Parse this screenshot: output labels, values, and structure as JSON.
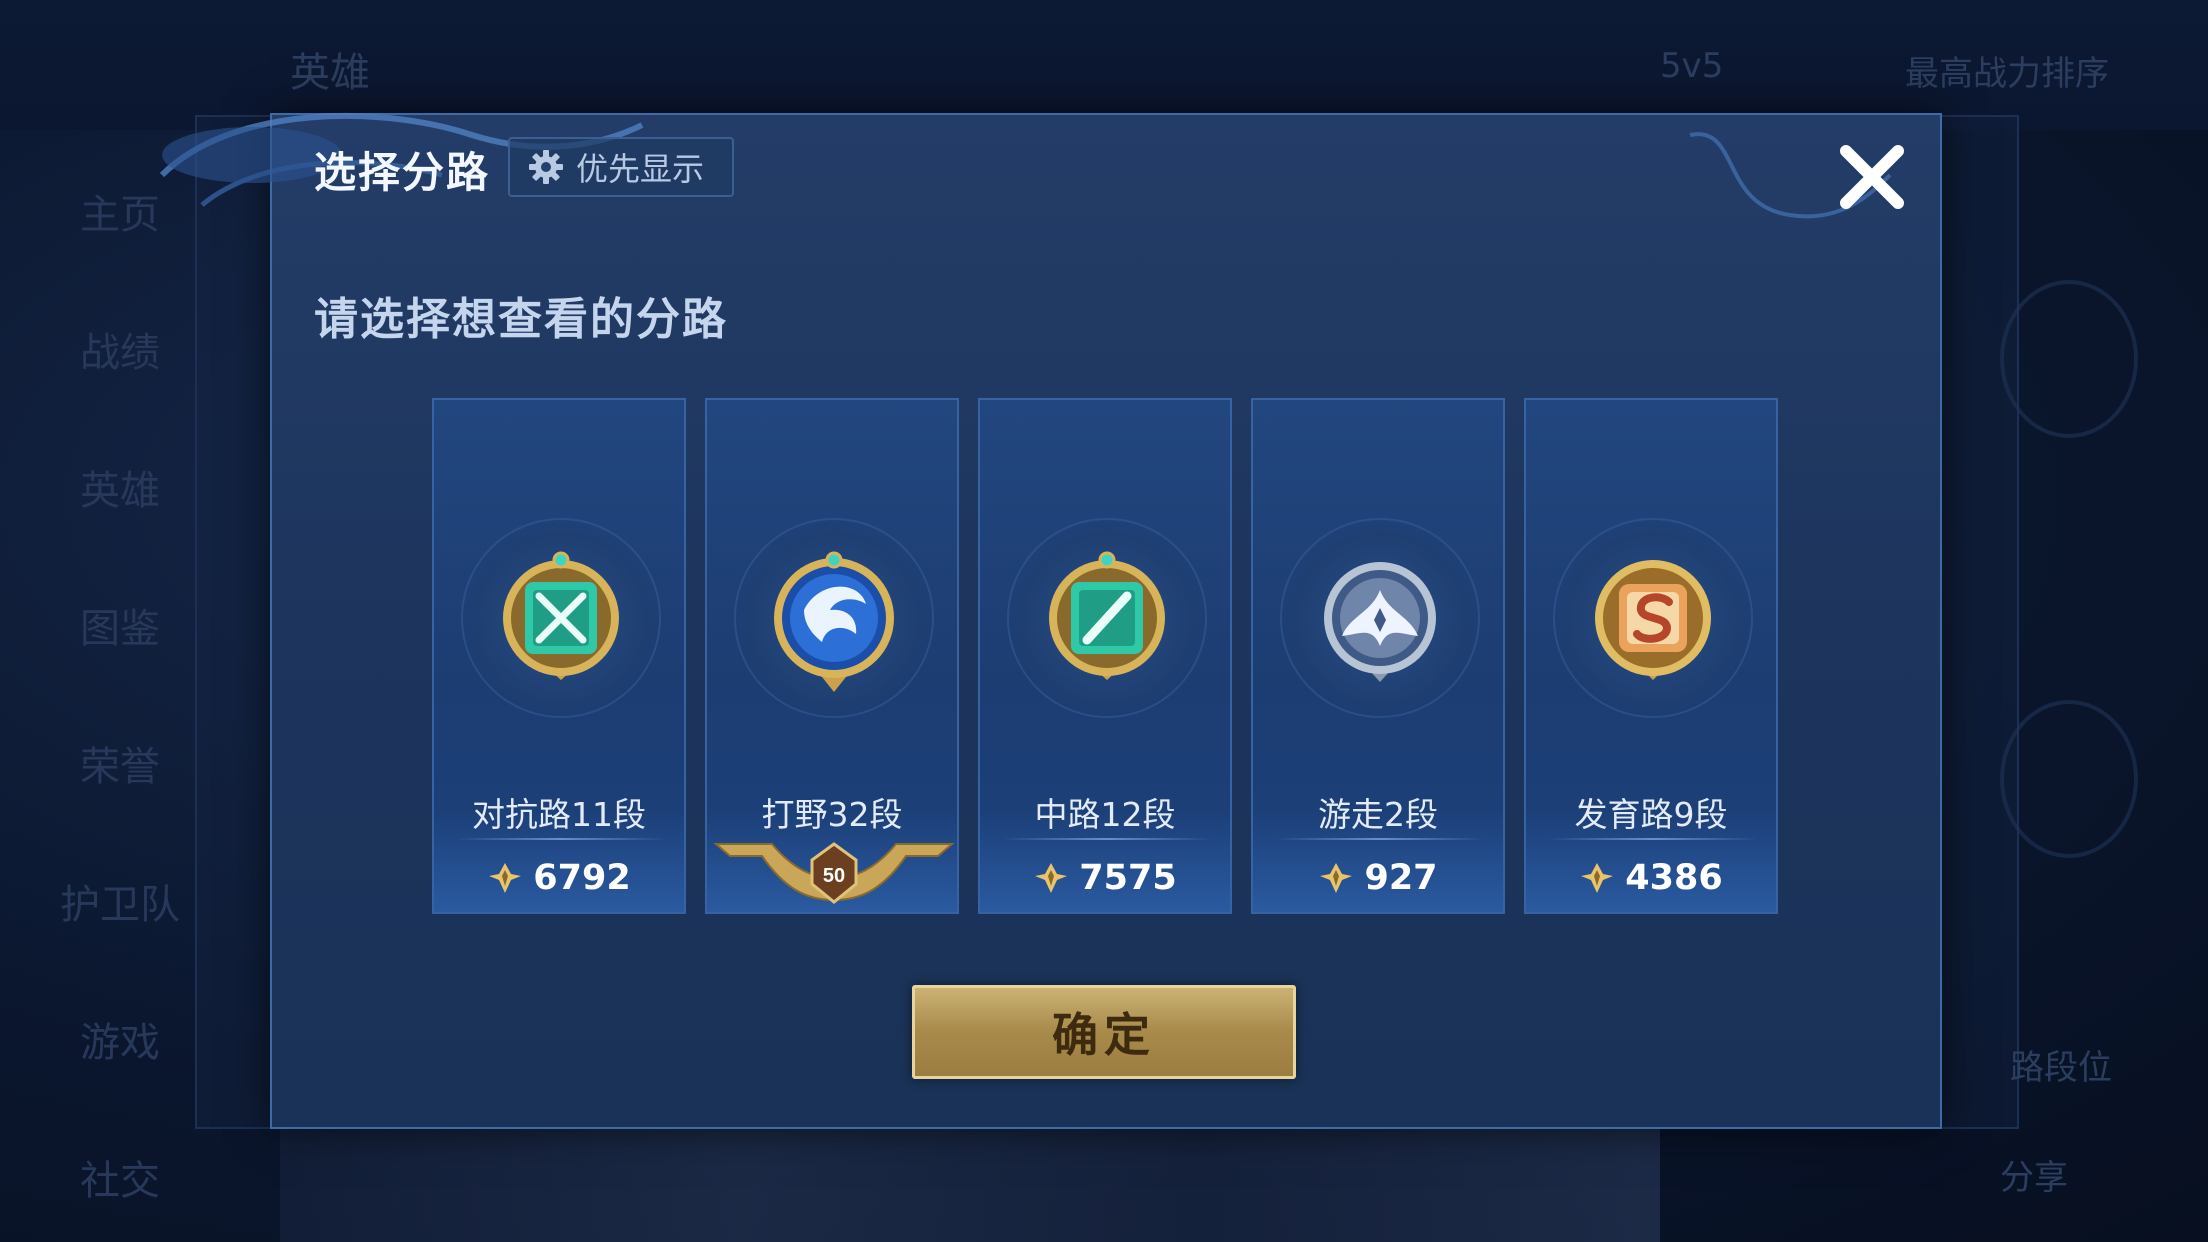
{
  "background": {
    "top_tabs": [
      "英雄",
      "5v5",
      "最高战力排序"
    ],
    "sidebar_items": [
      "主页",
      "战绩",
      "英雄",
      "图鉴",
      "荣誉",
      "护卫队",
      "游戏",
      "社交"
    ],
    "right_texts": [
      "路段位",
      "分享"
    ]
  },
  "modal": {
    "title": "选择分路",
    "priority_label": "优先显示",
    "subtitle": "请选择想查看的分路",
    "confirm_label": "确定"
  },
  "lanes": [
    {
      "name": "对抗路11段",
      "score": "6792",
      "emblem": "green-crossed-swords-icon",
      "color": "#2fc9a7"
    },
    {
      "name": "打野32段",
      "badge": "50",
      "emblem": "blue-dragon-icon",
      "color": "#2c6fd6"
    },
    {
      "name": "中路12段",
      "score": "7575",
      "emblem": "green-slash-icon",
      "color": "#2fc9a7"
    },
    {
      "name": "游走2段",
      "score": "927",
      "emblem": "silver-wings-icon",
      "color": "#9fb3c9"
    },
    {
      "name": "发育路9段",
      "score": "4386",
      "emblem": "gold-s-icon",
      "color": "#e9a35d"
    }
  ],
  "colors": {
    "accent_gold": "#e6d49c",
    "panel_blue": "#1d355d",
    "border_blue": "#3e6aa6"
  }
}
